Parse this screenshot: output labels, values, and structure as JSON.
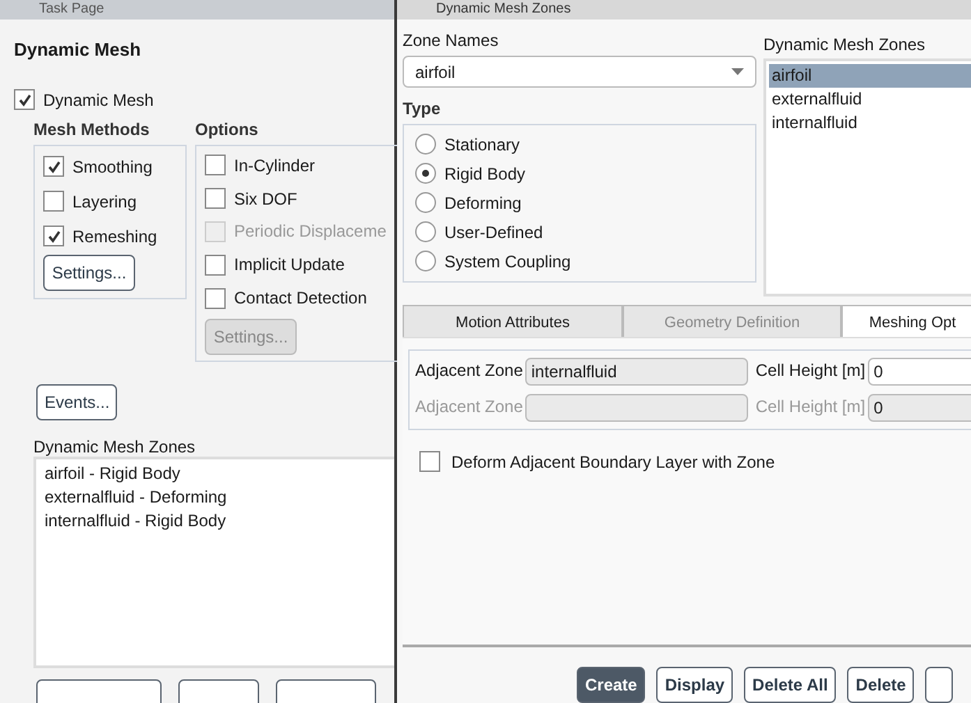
{
  "task_page": {
    "title": "Task Page",
    "heading": "Dynamic Mesh",
    "dynamic_mesh": {
      "label": "Dynamic Mesh",
      "checked": true
    },
    "mesh_methods": {
      "title": "Mesh Methods",
      "items": [
        {
          "label": "Smoothing",
          "checked": true
        },
        {
          "label": "Layering",
          "checked": false
        },
        {
          "label": "Remeshing",
          "checked": true
        }
      ],
      "button": {
        "label": "Settings...",
        "disabled": false
      }
    },
    "options": {
      "title": "Options",
      "items": [
        {
          "label": "In-Cylinder",
          "checked": false,
          "disabled": false
        },
        {
          "label": "Six DOF",
          "checked": false,
          "disabled": false
        },
        {
          "label": "Periodic Displaceme",
          "checked": false,
          "disabled": true
        },
        {
          "label": "Implicit Update",
          "checked": false,
          "disabled": false
        },
        {
          "label": "Contact Detection",
          "checked": false,
          "disabled": false
        }
      ],
      "button": {
        "label": "Settings...",
        "disabled": true
      }
    },
    "events_button": "Events...",
    "zones_label": "Dynamic Mesh Zones",
    "zones": [
      "airfoil - Rigid Body",
      "externalfluid - Deforming",
      "internalfluid - Rigid Body"
    ]
  },
  "dialog": {
    "title": "Dynamic Mesh Zones",
    "zone_names": {
      "label": "Zone Names",
      "value": "airfoil"
    },
    "type": {
      "title": "Type",
      "options": [
        {
          "label": "Stationary",
          "selected": false
        },
        {
          "label": "Rigid Body",
          "selected": true
        },
        {
          "label": "Deforming",
          "selected": false
        },
        {
          "label": "User-Defined",
          "selected": false
        },
        {
          "label": "System Coupling",
          "selected": false
        }
      ]
    },
    "zones_list": {
      "label": "Dynamic Mesh Zones",
      "items": [
        {
          "label": "airfoil",
          "selected": true
        },
        {
          "label": "externalfluid",
          "selected": false
        },
        {
          "label": "internalfluid",
          "selected": false
        }
      ]
    },
    "tabs": [
      {
        "label": "Motion Attributes",
        "selected": false,
        "disabled": false
      },
      {
        "label": "Geometry Definition",
        "selected": false,
        "disabled": true
      },
      {
        "label": "Meshing Opt",
        "selected": true,
        "disabled": false
      }
    ],
    "adjacent_rows": [
      {
        "zone_label": "Adjacent Zone",
        "zone_value": "internalfluid",
        "height_label": "Cell Height [m]",
        "height_value": "0",
        "disabled": false
      },
      {
        "zone_label": "Adjacent Zone",
        "zone_value": "",
        "height_label": "Cell Height [m]",
        "height_value": "0",
        "disabled": true
      }
    ],
    "deform_layer": {
      "label": "Deform Adjacent Boundary Layer with Zone",
      "checked": false
    },
    "buttons": [
      {
        "label": "Create",
        "kind": "primary"
      },
      {
        "label": "Display",
        "kind": "normal"
      },
      {
        "label": "Delete All",
        "kind": "normal"
      },
      {
        "label": "Delete",
        "kind": "normal"
      }
    ]
  }
}
